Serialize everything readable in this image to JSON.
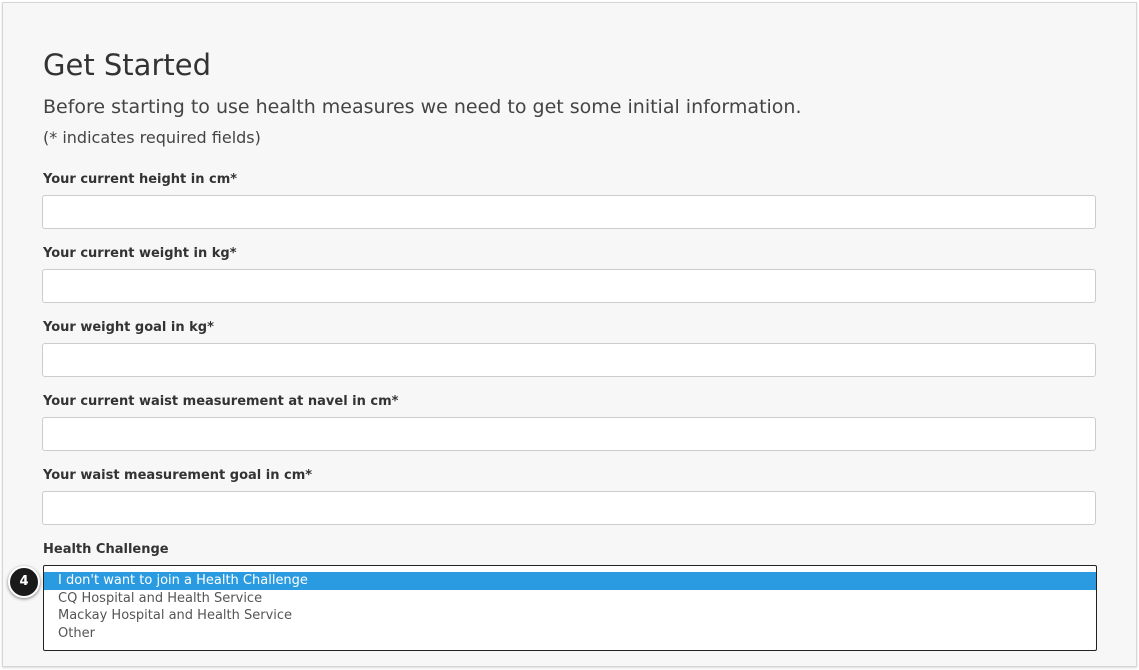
{
  "page": {
    "title": "Get Started",
    "subtitle": "Before starting to use health measures we need to get some initial information.",
    "required_note": "(* indicates required fields)"
  },
  "fields": [
    {
      "label": "Your current height in cm*",
      "value": ""
    },
    {
      "label": "Your current weight in kg*",
      "value": ""
    },
    {
      "label": "Your weight goal in kg*",
      "value": ""
    },
    {
      "label": "Your current waist measurement at navel in cm*",
      "value": ""
    },
    {
      "label": "Your waist measurement goal in cm*",
      "value": ""
    }
  ],
  "health_challenge": {
    "label": "Health Challenge",
    "options": [
      "I don't want to join a Health Challenge",
      "CQ Hospital and Health Service",
      "Mackay Hospital and Health Service",
      "Other"
    ],
    "selected_index": 0
  },
  "annotation": {
    "step_number": "4"
  },
  "colors": {
    "selected_option_bg": "#2a9be0",
    "page_bg": "#f7f7f7",
    "badge_bg": "#1a1a1a"
  }
}
